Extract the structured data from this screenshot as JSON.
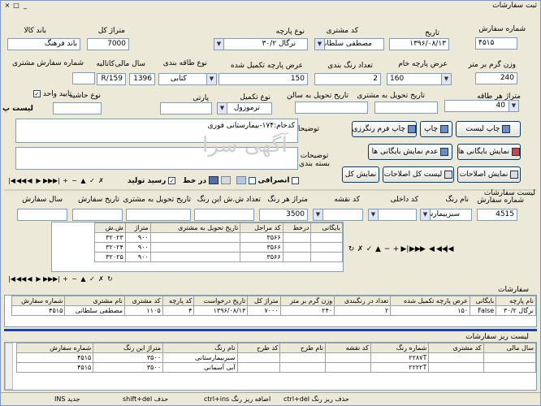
{
  "window": {
    "title": "ثبت سفارشات",
    "min": "_",
    "max": "□",
    "close": "×"
  },
  "form": {
    "order_no_label": "شماره سفارش",
    "order_no": "۴۵۱۵",
    "date_label": "تاریخ",
    "date": "۱۳۹۶/۰۸/۱۳",
    "customer_code_label": "کد مشتری",
    "customer": "مصطفی سلطانی",
    "fabric_type_label": "نوع پارچه",
    "fabric_type": "نرگال ۳۰/۲",
    "meterage_label": "متراژ کل",
    "meterage": "7000",
    "band_label": "باند کالا",
    "band": "باند فرهنگ",
    "gram_label": "وزن گرم بر متر",
    "gram": "240",
    "raw_width_label": "عرض پارچه خام",
    "raw_width": "160",
    "color_count_label": "تعداد رنگ بندی",
    "color_count": "2",
    "final_width_label": "عرض پارچه تکمیل شده",
    "final_width": "150",
    "fold_type_label": "نوع طاقه بندی",
    "fold_type": "کتابی",
    "fin_year_label": "سال مالی",
    "fin_year": "1396",
    "catalog_label": "کاتالیه",
    "catalog": "R/159",
    "cust_order_no_label": "شماره سفارش مشتری",
    "cust_order_no": "",
    "meter_per_fold_label": "متراژ هر طاقه",
    "meter_per_fold": "40",
    "deliv_cust_label": "تاریخ تحویل به مشتری",
    "deliv_cust": "",
    "deliv_hall_label": "تاریخ تحویل به سالن",
    "deliv_hall": "",
    "finish_type_label": "نوع تکمیل",
    "finish_type": "ترموزول",
    "lot_label": "پارتی",
    "lot": "",
    "margin_type_label": "نوع حاشیه",
    "margin_type": "",
    "unit_approve_label": "تایید واحد",
    "unit_approve": "✓",
    "list_label": "لیست پ",
    "desc_label": "توضیحات",
    "desc": "کدخام:۱۷۴-بیمارستانی فوری",
    "pack_desc_label": "توضیحات بسته بندی",
    "pack_desc": ""
  },
  "buttons": {
    "print_list": "چاپ لیست",
    "print": "چاپ",
    "print_color": "چاپ فرم رنگرزی",
    "show_archive": "نمایش بایگانی ها",
    "no_archive": "عدم نمایش بایگانی ها",
    "show_corrections": "نمایش اصلاحات",
    "all_corrections": "لیست کل اصلاحات",
    "show_all": "نمایش کل"
  },
  "toolbar1": {
    "production_receipt": "رسید تولید",
    "online": "در خط",
    "deviation": "انصرافی"
  },
  "order_list": {
    "title": "لیست سفارشات",
    "order_no_label": "شماره سفارش",
    "order_no": "4515",
    "color_name_label": "نام رنگ",
    "color_name": "سبزبیمارستا",
    "internal_code_label": "کد داخلی",
    "internal_code": "",
    "design_code_label": "کد نقشه",
    "design_code": "",
    "meter_per_color_label": "متراژ هر رنگ",
    "meter_per_color": "3500",
    "sh_count_label": "تعداد ش.ش این رنگ",
    "sh_count": "",
    "deliv_label": "تاریخ تحویل به مشتری",
    "deliv": "",
    "order_date_label": "تاریخ سفارش",
    "order_date": "",
    "year_label": "سال سفارش",
    "year": ""
  },
  "sub_grid": {
    "headers": [
      "ش.ش",
      "متراژ",
      "تاریخ تحویل به مشتری",
      "کد مراحل",
      "درخط",
      "بایگانی"
    ],
    "rows": [
      [
        "۳۲۰۲۳",
        "۹۰۰",
        "",
        "۳۵۶۶",
        "",
        ""
      ],
      [
        "۳۲۰۲۴",
        "۹۰۰",
        "",
        "۳۵۶۶",
        "",
        ""
      ],
      [
        "۳۲۰۲۵",
        "۹۰۰",
        "",
        "۳۵۶۶",
        "",
        ""
      ]
    ]
  },
  "orders": {
    "title": "سفارشات",
    "headers": [
      "شماره سفارش",
      "نام مشتری",
      "کد مشتری",
      "کد پارچه",
      "تاریخ درخواست",
      "متراژ کل",
      "وزن گرم بر متر",
      "تعداد در رنگبندی",
      "عرض پارچه تکمیل شده",
      "بایگانی",
      "نام پارچه"
    ],
    "rows": [
      [
        "۴۵۱۵",
        "مصطفی سلطانی",
        "۱۱۰۵",
        "۴",
        "۱۳۹۶/۰۸/۱۳",
        "۷۰۰۰",
        "۲۴۰",
        "۲",
        "۱۵۰",
        "False",
        "نرگال ۳۰/۲"
      ]
    ]
  },
  "sub_orders": {
    "title": "لیست ریز سفارشات",
    "headers": [
      "شماره سفارش",
      "متراژ این رنگ",
      "نام رنگ",
      "کد طرح",
      "نام طرح",
      "کد نقشه",
      "شماره رنگ",
      "کد مشتری",
      "سال مالی"
    ],
    "rows": [
      [
        "۴۵۱۵",
        "۳۵۰۰",
        "سبزبیمارستانی",
        "",
        "",
        "",
        "۲۲۸۷T",
        "",
        ""
      ],
      [
        "۴۵۱۵",
        "۳۵۰۰",
        "آبی آسمانی",
        "",
        "",
        "",
        "۲۲۲۲T",
        "",
        ""
      ]
    ]
  },
  "statusbar": {
    "s1": "ctrl+del حذف ریز رنگ",
    "s2": "ctrl+ins اضافه ریز رنگ",
    "s3": "shift+del حذف",
    "s4": "INS جدید"
  },
  "watermark": "آگهی سرا"
}
